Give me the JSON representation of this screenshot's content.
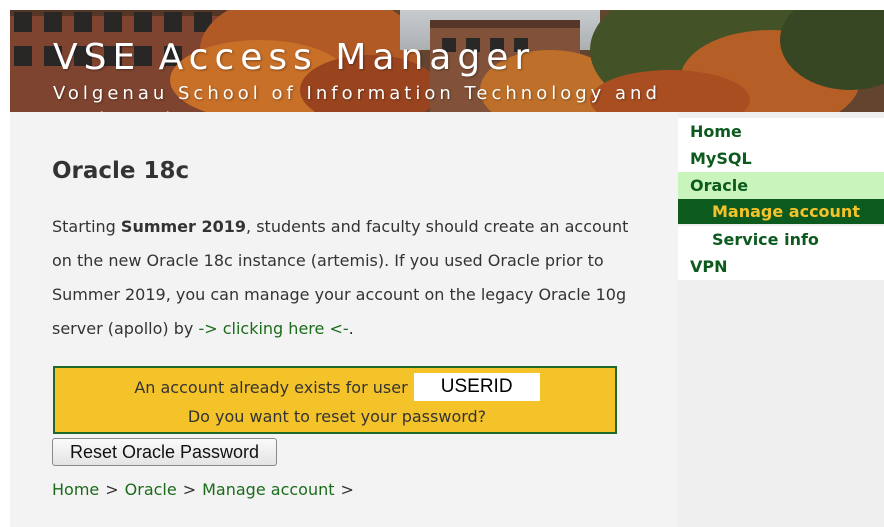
{
  "header": {
    "title": "VSE Access Manager",
    "subtitle": "Volgenau School of Information Technology and Engineering"
  },
  "main": {
    "title": "Oracle 18c",
    "intro": {
      "part1": "Starting ",
      "bold": "Summer 2019",
      "part2": ", students and faculty should create an account on the new Oracle 18c instance (artemis). If you used Oracle prior to Summer 2019, you can manage your account on the legacy Oracle 10g server (apollo) by ",
      "link": "-> clicking here <-",
      "part3": "."
    },
    "notice": {
      "line1": "An account already exists for user",
      "userid": "USERID",
      "line2": "Do you want to reset your password?"
    },
    "reset_button": "Reset Oracle Password",
    "breadcrumb": [
      {
        "label": "Home"
      },
      {
        "label": "Oracle"
      },
      {
        "label": "Manage account"
      }
    ],
    "breadcrumb_sep": ">"
  },
  "sidebar": {
    "items": [
      {
        "label": "Home"
      },
      {
        "label": "MySQL"
      },
      {
        "label": "Oracle"
      },
      {
        "label": "Manage account"
      },
      {
        "label": "Service info"
      },
      {
        "label": "VPN"
      }
    ]
  },
  "colors": {
    "accent_green": "#0d5a1e",
    "notice_yellow": "#f4c32a",
    "active_parent": "#c9f5bd",
    "link_green": "#1b6b1b"
  }
}
